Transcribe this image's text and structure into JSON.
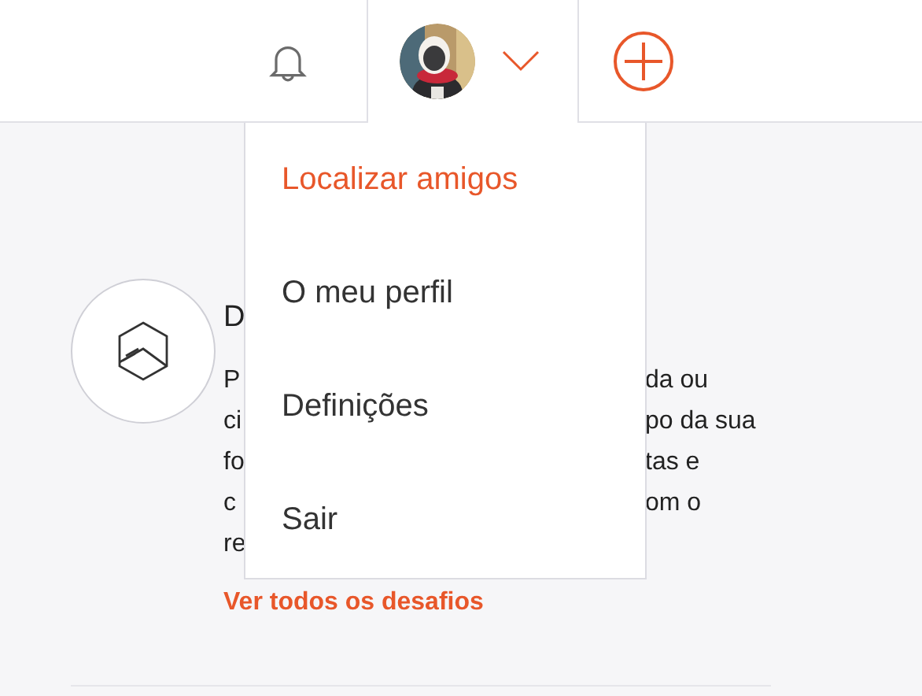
{
  "header": {
    "notifications": {
      "kind": "bell"
    },
    "profile": {
      "expanded": true
    },
    "add": {
      "kind": "plus"
    }
  },
  "menu": {
    "items": [
      {
        "label": "Localizar amigos",
        "selected": true
      },
      {
        "label": "O meu perfil",
        "selected": false
      },
      {
        "label": "Definições",
        "selected": false
      },
      {
        "label": "Sair",
        "selected": false
      }
    ]
  },
  "challenge": {
    "title": "D",
    "lines": [
      {
        "left": "P",
        "right": "da ou"
      },
      {
        "left": "ci",
        "right": "po da sua"
      },
      {
        "left": "fo",
        "right": "tas e"
      },
      {
        "left": "c",
        "right": "om o"
      },
      {
        "left": "re"
      }
    ],
    "link": "Ver todos os desafios"
  }
}
